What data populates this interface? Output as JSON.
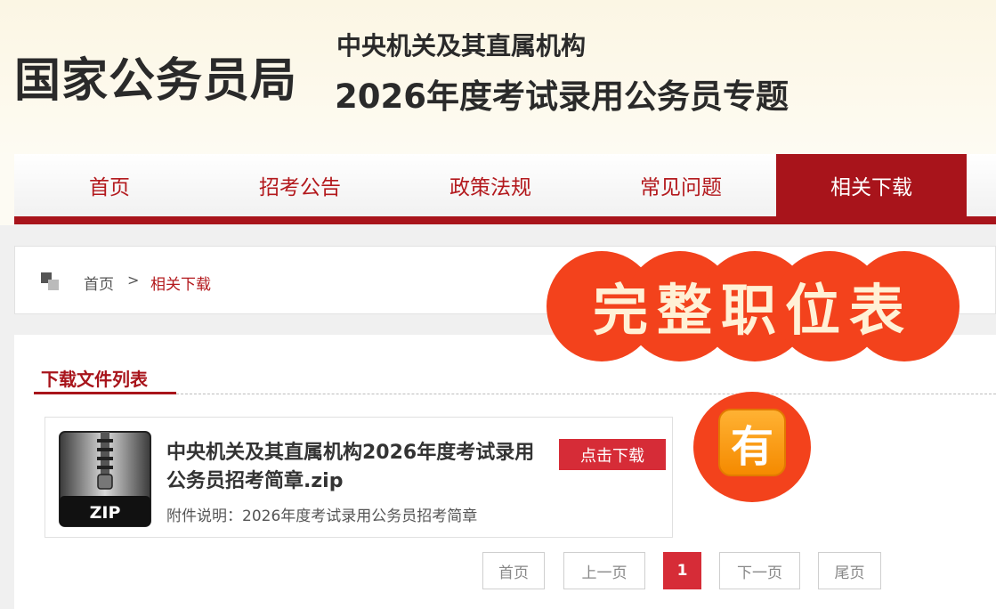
{
  "header": {
    "site_name": "国家公务员局",
    "topic_line1": "中央机关及其直属机构",
    "topic_line2": "2026年度考试录用公务员专题"
  },
  "nav": {
    "items": [
      {
        "label": "首页"
      },
      {
        "label": "招考公告"
      },
      {
        "label": "政策法规"
      },
      {
        "label": "常见问题"
      },
      {
        "label": "相关下载"
      }
    ],
    "active_index": 4
  },
  "breadcrumb": {
    "home": "首页",
    "separator": ">",
    "current": "相关下载"
  },
  "download_list": {
    "title": "下载文件列表",
    "files": [
      {
        "name": "中央机关及其直属机构2026年度考试录用公务员招考简章.zip",
        "description": "附件说明：2026年度考试录用公务员招考简章",
        "icon_label": "ZIP",
        "icon": "zip-file-icon",
        "button_label": "点击下载"
      }
    ]
  },
  "pagination": {
    "first": "首页",
    "prev": "上一页",
    "current": "1",
    "next": "下一页",
    "last": "尾页"
  },
  "overlay": {
    "badge_text": "完整职位表",
    "emoji_char": "有"
  },
  "colors": {
    "primary_red": "#a8141b",
    "button_red": "#d62c37",
    "overlay_orange": "#f3421c"
  }
}
